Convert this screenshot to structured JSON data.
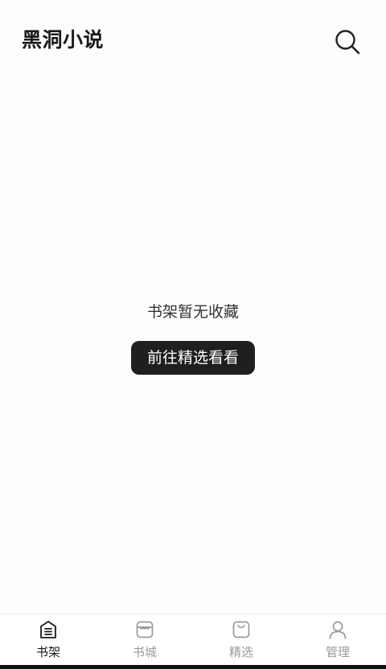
{
  "header": {
    "title": "黑洞小说",
    "search_icon": "search-icon"
  },
  "empty_state": {
    "message": "书架暂无收藏",
    "button_label": "前往精选看看"
  },
  "tabbar": {
    "active_index": 0,
    "active_color": "#1a1a1a",
    "inactive_color": "#9a9a9a",
    "items": [
      {
        "label": "书架",
        "icon": "bookshelf-icon"
      },
      {
        "label": "书城",
        "icon": "bookstore-icon"
      },
      {
        "label": "精选",
        "icon": "featured-bag-icon"
      },
      {
        "label": "管理",
        "icon": "user-icon"
      }
    ]
  }
}
